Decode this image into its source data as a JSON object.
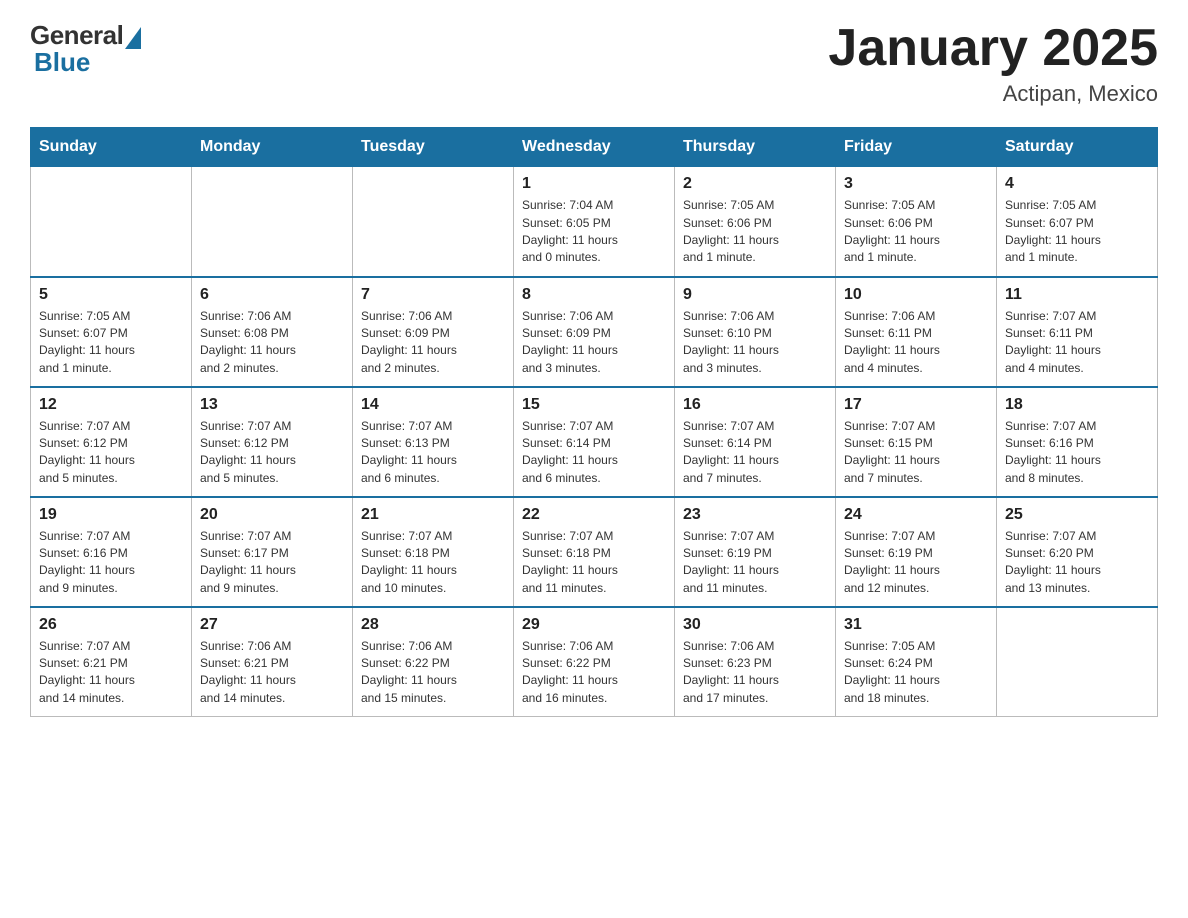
{
  "header": {
    "logo_general": "General",
    "logo_blue": "Blue",
    "month_title": "January 2025",
    "location": "Actipan, Mexico"
  },
  "days_of_week": [
    "Sunday",
    "Monday",
    "Tuesday",
    "Wednesday",
    "Thursday",
    "Friday",
    "Saturday"
  ],
  "weeks": [
    [
      {
        "day": "",
        "info": ""
      },
      {
        "day": "",
        "info": ""
      },
      {
        "day": "",
        "info": ""
      },
      {
        "day": "1",
        "info": "Sunrise: 7:04 AM\nSunset: 6:05 PM\nDaylight: 11 hours\nand 0 minutes."
      },
      {
        "day": "2",
        "info": "Sunrise: 7:05 AM\nSunset: 6:06 PM\nDaylight: 11 hours\nand 1 minute."
      },
      {
        "day": "3",
        "info": "Sunrise: 7:05 AM\nSunset: 6:06 PM\nDaylight: 11 hours\nand 1 minute."
      },
      {
        "day": "4",
        "info": "Sunrise: 7:05 AM\nSunset: 6:07 PM\nDaylight: 11 hours\nand 1 minute."
      }
    ],
    [
      {
        "day": "5",
        "info": "Sunrise: 7:05 AM\nSunset: 6:07 PM\nDaylight: 11 hours\nand 1 minute."
      },
      {
        "day": "6",
        "info": "Sunrise: 7:06 AM\nSunset: 6:08 PM\nDaylight: 11 hours\nand 2 minutes."
      },
      {
        "day": "7",
        "info": "Sunrise: 7:06 AM\nSunset: 6:09 PM\nDaylight: 11 hours\nand 2 minutes."
      },
      {
        "day": "8",
        "info": "Sunrise: 7:06 AM\nSunset: 6:09 PM\nDaylight: 11 hours\nand 3 minutes."
      },
      {
        "day": "9",
        "info": "Sunrise: 7:06 AM\nSunset: 6:10 PM\nDaylight: 11 hours\nand 3 minutes."
      },
      {
        "day": "10",
        "info": "Sunrise: 7:06 AM\nSunset: 6:11 PM\nDaylight: 11 hours\nand 4 minutes."
      },
      {
        "day": "11",
        "info": "Sunrise: 7:07 AM\nSunset: 6:11 PM\nDaylight: 11 hours\nand 4 minutes."
      }
    ],
    [
      {
        "day": "12",
        "info": "Sunrise: 7:07 AM\nSunset: 6:12 PM\nDaylight: 11 hours\nand 5 minutes."
      },
      {
        "day": "13",
        "info": "Sunrise: 7:07 AM\nSunset: 6:12 PM\nDaylight: 11 hours\nand 5 minutes."
      },
      {
        "day": "14",
        "info": "Sunrise: 7:07 AM\nSunset: 6:13 PM\nDaylight: 11 hours\nand 6 minutes."
      },
      {
        "day": "15",
        "info": "Sunrise: 7:07 AM\nSunset: 6:14 PM\nDaylight: 11 hours\nand 6 minutes."
      },
      {
        "day": "16",
        "info": "Sunrise: 7:07 AM\nSunset: 6:14 PM\nDaylight: 11 hours\nand 7 minutes."
      },
      {
        "day": "17",
        "info": "Sunrise: 7:07 AM\nSunset: 6:15 PM\nDaylight: 11 hours\nand 7 minutes."
      },
      {
        "day": "18",
        "info": "Sunrise: 7:07 AM\nSunset: 6:16 PM\nDaylight: 11 hours\nand 8 minutes."
      }
    ],
    [
      {
        "day": "19",
        "info": "Sunrise: 7:07 AM\nSunset: 6:16 PM\nDaylight: 11 hours\nand 9 minutes."
      },
      {
        "day": "20",
        "info": "Sunrise: 7:07 AM\nSunset: 6:17 PM\nDaylight: 11 hours\nand 9 minutes."
      },
      {
        "day": "21",
        "info": "Sunrise: 7:07 AM\nSunset: 6:18 PM\nDaylight: 11 hours\nand 10 minutes."
      },
      {
        "day": "22",
        "info": "Sunrise: 7:07 AM\nSunset: 6:18 PM\nDaylight: 11 hours\nand 11 minutes."
      },
      {
        "day": "23",
        "info": "Sunrise: 7:07 AM\nSunset: 6:19 PM\nDaylight: 11 hours\nand 11 minutes."
      },
      {
        "day": "24",
        "info": "Sunrise: 7:07 AM\nSunset: 6:19 PM\nDaylight: 11 hours\nand 12 minutes."
      },
      {
        "day": "25",
        "info": "Sunrise: 7:07 AM\nSunset: 6:20 PM\nDaylight: 11 hours\nand 13 minutes."
      }
    ],
    [
      {
        "day": "26",
        "info": "Sunrise: 7:07 AM\nSunset: 6:21 PM\nDaylight: 11 hours\nand 14 minutes."
      },
      {
        "day": "27",
        "info": "Sunrise: 7:06 AM\nSunset: 6:21 PM\nDaylight: 11 hours\nand 14 minutes."
      },
      {
        "day": "28",
        "info": "Sunrise: 7:06 AM\nSunset: 6:22 PM\nDaylight: 11 hours\nand 15 minutes."
      },
      {
        "day": "29",
        "info": "Sunrise: 7:06 AM\nSunset: 6:22 PM\nDaylight: 11 hours\nand 16 minutes."
      },
      {
        "day": "30",
        "info": "Sunrise: 7:06 AM\nSunset: 6:23 PM\nDaylight: 11 hours\nand 17 minutes."
      },
      {
        "day": "31",
        "info": "Sunrise: 7:05 AM\nSunset: 6:24 PM\nDaylight: 11 hours\nand 18 minutes."
      },
      {
        "day": "",
        "info": ""
      }
    ]
  ]
}
